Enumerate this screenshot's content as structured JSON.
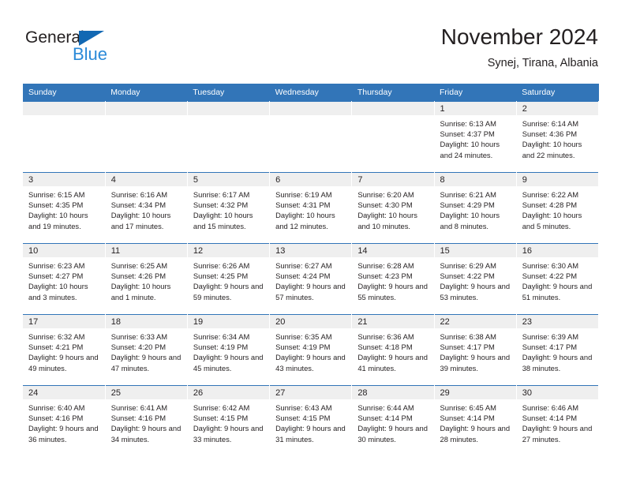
{
  "brand": {
    "name_part1": "General",
    "name_part2": "Blue",
    "triangle_icon": "triangle-icon",
    "accent_blue": "#2b8ad8",
    "logo_blue": "#1268b3"
  },
  "header": {
    "title": "November 2024",
    "subtitle": "Synej, Tirana, Albania"
  },
  "theme": {
    "header_bg": "#3275b8",
    "daynum_bg": "#efefef",
    "text": "#231f20"
  },
  "calendar": {
    "weekday_headers": [
      "Sunday",
      "Monday",
      "Tuesday",
      "Wednesday",
      "Thursday",
      "Friday",
      "Saturday"
    ],
    "weeks": [
      [
        {
          "day": "",
          "sunrise": "",
          "sunset": "",
          "daylight": "",
          "empty": true
        },
        {
          "day": "",
          "sunrise": "",
          "sunset": "",
          "daylight": "",
          "empty": true
        },
        {
          "day": "",
          "sunrise": "",
          "sunset": "",
          "daylight": "",
          "empty": true
        },
        {
          "day": "",
          "sunrise": "",
          "sunset": "",
          "daylight": "",
          "empty": true
        },
        {
          "day": "",
          "sunrise": "",
          "sunset": "",
          "daylight": "",
          "empty": true
        },
        {
          "day": "1",
          "sunrise": "Sunrise: 6:13 AM",
          "sunset": "Sunset: 4:37 PM",
          "daylight": "Daylight: 10 hours and 24 minutes.",
          "empty": false
        },
        {
          "day": "2",
          "sunrise": "Sunrise: 6:14 AM",
          "sunset": "Sunset: 4:36 PM",
          "daylight": "Daylight: 10 hours and 22 minutes.",
          "empty": false
        }
      ],
      [
        {
          "day": "3",
          "sunrise": "Sunrise: 6:15 AM",
          "sunset": "Sunset: 4:35 PM",
          "daylight": "Daylight: 10 hours and 19 minutes.",
          "empty": false
        },
        {
          "day": "4",
          "sunrise": "Sunrise: 6:16 AM",
          "sunset": "Sunset: 4:34 PM",
          "daylight": "Daylight: 10 hours and 17 minutes.",
          "empty": false
        },
        {
          "day": "5",
          "sunrise": "Sunrise: 6:17 AM",
          "sunset": "Sunset: 4:32 PM",
          "daylight": "Daylight: 10 hours and 15 minutes.",
          "empty": false
        },
        {
          "day": "6",
          "sunrise": "Sunrise: 6:19 AM",
          "sunset": "Sunset: 4:31 PM",
          "daylight": "Daylight: 10 hours and 12 minutes.",
          "empty": false
        },
        {
          "day": "7",
          "sunrise": "Sunrise: 6:20 AM",
          "sunset": "Sunset: 4:30 PM",
          "daylight": "Daylight: 10 hours and 10 minutes.",
          "empty": false
        },
        {
          "day": "8",
          "sunrise": "Sunrise: 6:21 AM",
          "sunset": "Sunset: 4:29 PM",
          "daylight": "Daylight: 10 hours and 8 minutes.",
          "empty": false
        },
        {
          "day": "9",
          "sunrise": "Sunrise: 6:22 AM",
          "sunset": "Sunset: 4:28 PM",
          "daylight": "Daylight: 10 hours and 5 minutes.",
          "empty": false
        }
      ],
      [
        {
          "day": "10",
          "sunrise": "Sunrise: 6:23 AM",
          "sunset": "Sunset: 4:27 PM",
          "daylight": "Daylight: 10 hours and 3 minutes.",
          "empty": false
        },
        {
          "day": "11",
          "sunrise": "Sunrise: 6:25 AM",
          "sunset": "Sunset: 4:26 PM",
          "daylight": "Daylight: 10 hours and 1 minute.",
          "empty": false
        },
        {
          "day": "12",
          "sunrise": "Sunrise: 6:26 AM",
          "sunset": "Sunset: 4:25 PM",
          "daylight": "Daylight: 9 hours and 59 minutes.",
          "empty": false
        },
        {
          "day": "13",
          "sunrise": "Sunrise: 6:27 AM",
          "sunset": "Sunset: 4:24 PM",
          "daylight": "Daylight: 9 hours and 57 minutes.",
          "empty": false
        },
        {
          "day": "14",
          "sunrise": "Sunrise: 6:28 AM",
          "sunset": "Sunset: 4:23 PM",
          "daylight": "Daylight: 9 hours and 55 minutes.",
          "empty": false
        },
        {
          "day": "15",
          "sunrise": "Sunrise: 6:29 AM",
          "sunset": "Sunset: 4:22 PM",
          "daylight": "Daylight: 9 hours and 53 minutes.",
          "empty": false
        },
        {
          "day": "16",
          "sunrise": "Sunrise: 6:30 AM",
          "sunset": "Sunset: 4:22 PM",
          "daylight": "Daylight: 9 hours and 51 minutes.",
          "empty": false
        }
      ],
      [
        {
          "day": "17",
          "sunrise": "Sunrise: 6:32 AM",
          "sunset": "Sunset: 4:21 PM",
          "daylight": "Daylight: 9 hours and 49 minutes.",
          "empty": false
        },
        {
          "day": "18",
          "sunrise": "Sunrise: 6:33 AM",
          "sunset": "Sunset: 4:20 PM",
          "daylight": "Daylight: 9 hours and 47 minutes.",
          "empty": false
        },
        {
          "day": "19",
          "sunrise": "Sunrise: 6:34 AM",
          "sunset": "Sunset: 4:19 PM",
          "daylight": "Daylight: 9 hours and 45 minutes.",
          "empty": false
        },
        {
          "day": "20",
          "sunrise": "Sunrise: 6:35 AM",
          "sunset": "Sunset: 4:19 PM",
          "daylight": "Daylight: 9 hours and 43 minutes.",
          "empty": false
        },
        {
          "day": "21",
          "sunrise": "Sunrise: 6:36 AM",
          "sunset": "Sunset: 4:18 PM",
          "daylight": "Daylight: 9 hours and 41 minutes.",
          "empty": false
        },
        {
          "day": "22",
          "sunrise": "Sunrise: 6:38 AM",
          "sunset": "Sunset: 4:17 PM",
          "daylight": "Daylight: 9 hours and 39 minutes.",
          "empty": false
        },
        {
          "day": "23",
          "sunrise": "Sunrise: 6:39 AM",
          "sunset": "Sunset: 4:17 PM",
          "daylight": "Daylight: 9 hours and 38 minutes.",
          "empty": false
        }
      ],
      [
        {
          "day": "24",
          "sunrise": "Sunrise: 6:40 AM",
          "sunset": "Sunset: 4:16 PM",
          "daylight": "Daylight: 9 hours and 36 minutes.",
          "empty": false
        },
        {
          "day": "25",
          "sunrise": "Sunrise: 6:41 AM",
          "sunset": "Sunset: 4:16 PM",
          "daylight": "Daylight: 9 hours and 34 minutes.",
          "empty": false
        },
        {
          "day": "26",
          "sunrise": "Sunrise: 6:42 AM",
          "sunset": "Sunset: 4:15 PM",
          "daylight": "Daylight: 9 hours and 33 minutes.",
          "empty": false
        },
        {
          "day": "27",
          "sunrise": "Sunrise: 6:43 AM",
          "sunset": "Sunset: 4:15 PM",
          "daylight": "Daylight: 9 hours and 31 minutes.",
          "empty": false
        },
        {
          "day": "28",
          "sunrise": "Sunrise: 6:44 AM",
          "sunset": "Sunset: 4:14 PM",
          "daylight": "Daylight: 9 hours and 30 minutes.",
          "empty": false
        },
        {
          "day": "29",
          "sunrise": "Sunrise: 6:45 AM",
          "sunset": "Sunset: 4:14 PM",
          "daylight": "Daylight: 9 hours and 28 minutes.",
          "empty": false
        },
        {
          "day": "30",
          "sunrise": "Sunrise: 6:46 AM",
          "sunset": "Sunset: 4:14 PM",
          "daylight": "Daylight: 9 hours and 27 minutes.",
          "empty": false
        }
      ]
    ]
  }
}
